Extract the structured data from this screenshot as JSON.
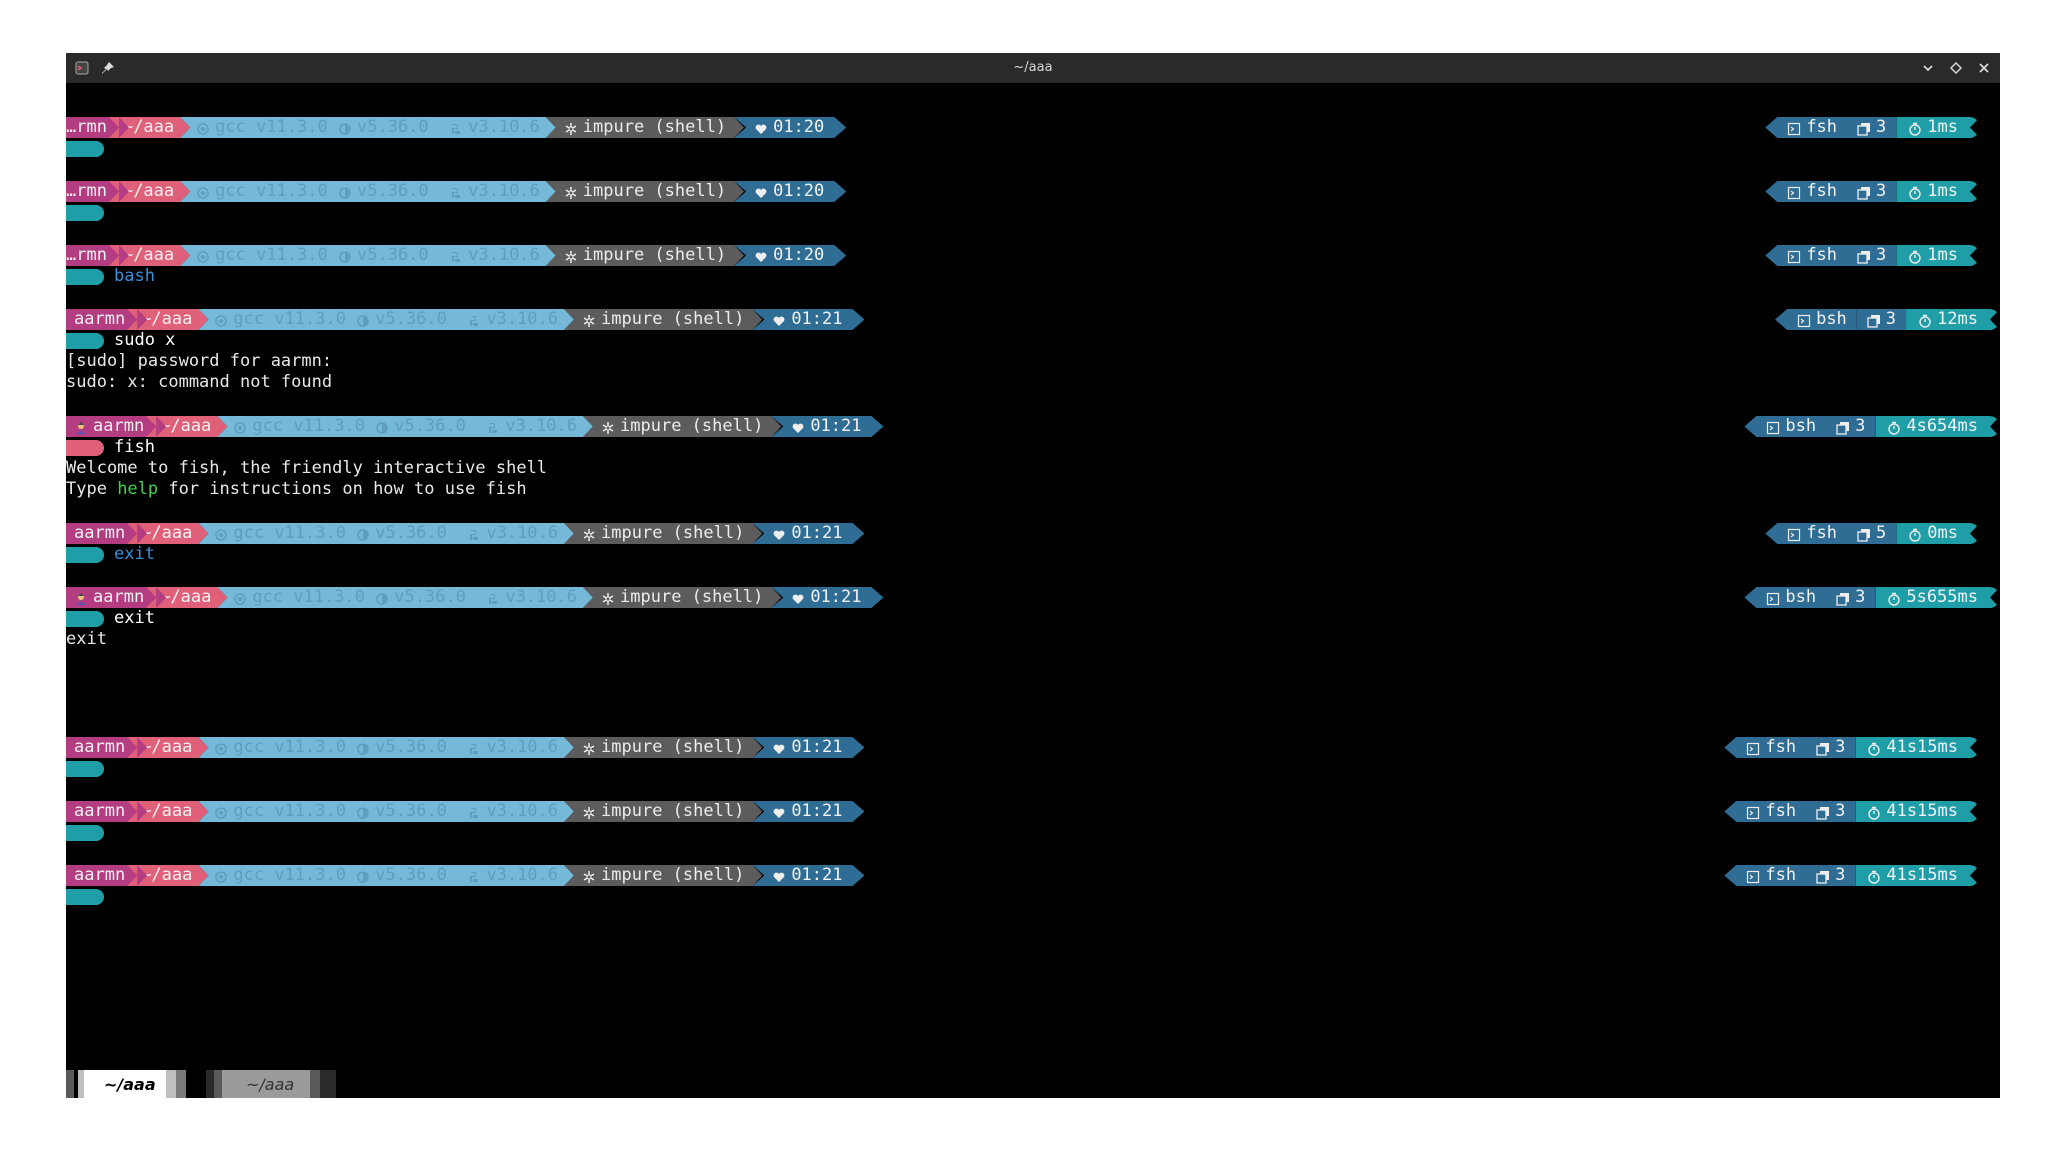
{
  "window": {
    "title": "~/aaa"
  },
  "colors": {
    "user": "#b43c80",
    "dir": "#e0607a",
    "tools": "#75b8d8",
    "nix": "#5c5c5c",
    "time": "#2f6d95",
    "duration": "#1f9ea8",
    "prompt_ok": "#1f9ea8",
    "prompt_err": "#e0607a"
  },
  "prompts": [
    {
      "user": "…rmn",
      "dir": "~/aaa",
      "gcc": "gcc v11.3.0",
      "perl": "v5.36.0",
      "python": "v3.10.6",
      "nix": "impure (shell)",
      "time": "01:20",
      "shell": "fsh",
      "jobs": "3",
      "duration": "1ms",
      "command": "",
      "command_color": "#ffffff",
      "pill": "ok"
    },
    {
      "user": "…rmn",
      "dir": "~/aaa",
      "gcc": "gcc v11.3.0",
      "perl": "v5.36.0",
      "python": "v3.10.6",
      "nix": "impure (shell)",
      "time": "01:20",
      "shell": "fsh",
      "jobs": "3",
      "duration": "1ms",
      "command": "",
      "command_color": "#ffffff",
      "pill": "ok"
    },
    {
      "user": "…rmn",
      "dir": "~/aaa",
      "gcc": "gcc v11.3.0",
      "perl": "v5.36.0",
      "python": "v3.10.6",
      "nix": "impure (shell)",
      "time": "01:20",
      "shell": "fsh",
      "jobs": "3",
      "duration": "1ms",
      "command": "bash",
      "command_color": "#3b8fd8",
      "pill": "ok"
    },
    {
      "user": "aarmn",
      "dir": "~/aaa",
      "gcc": "gcc v11.3.0",
      "perl": "v5.36.0",
      "python": "v3.10.6",
      "nix": "impure (shell)",
      "time": "01:21",
      "shell": "bsh",
      "jobs": "3",
      "duration": "12ms",
      "command": "sudo x",
      "command_color": "#ffffff",
      "pill": "ok"
    },
    {
      "user": "aarmn",
      "dir": "~/aaa",
      "gcc": "gcc v11.3.0",
      "perl": "v5.36.0",
      "python": "v3.10.6",
      "nix": "impure (shell)",
      "time": "01:21",
      "shell": "bsh",
      "jobs": "3",
      "duration": "4s654ms",
      "command": "fish",
      "command_color": "#ffffff",
      "pill": "err",
      "avatar": true
    },
    {
      "user": "aarmn",
      "dir": "~/aaa",
      "gcc": "gcc v11.3.0",
      "perl": "v5.36.0",
      "python": "v3.10.6",
      "nix": "impure (shell)",
      "time": "01:21",
      "shell": "fsh",
      "jobs": "5",
      "duration": "0ms",
      "command": "exit",
      "command_color": "#3b8fd8",
      "pill": "ok"
    },
    {
      "user": "aarmn",
      "dir": "~/aaa",
      "gcc": "gcc v11.3.0",
      "perl": "v5.36.0",
      "python": "v3.10.6",
      "nix": "impure (shell)",
      "time": "01:21",
      "shell": "bsh",
      "jobs": "3",
      "duration": "5s655ms",
      "command": "exit",
      "command_color": "#ffffff",
      "pill": "ok",
      "avatar": true
    },
    {
      "user": "aarmn",
      "dir": "~/aaa",
      "gcc": "gcc v11.3.0",
      "perl": "v5.36.0",
      "python": "v3.10.6",
      "nix": "impure (shell)",
      "time": "01:21",
      "shell": "fsh",
      "jobs": "3",
      "duration": "41s15ms",
      "command": "",
      "command_color": "#ffffff",
      "pill": "ok"
    },
    {
      "user": "aarmn",
      "dir": "~/aaa",
      "gcc": "gcc v11.3.0",
      "perl": "v5.36.0",
      "python": "v3.10.6",
      "nix": "impure (shell)",
      "time": "01:21",
      "shell": "fsh",
      "jobs": "3",
      "duration": "41s15ms",
      "command": "",
      "command_color": "#ffffff",
      "pill": "ok"
    },
    {
      "user": "aarmn",
      "dir": "~/aaa",
      "gcc": "gcc v11.3.0",
      "perl": "v5.36.0",
      "python": "v3.10.6",
      "nix": "impure (shell)",
      "time": "01:21",
      "shell": "fsh",
      "jobs": "3",
      "duration": "41s15ms",
      "command": "",
      "command_color": "#ffffff",
      "pill": "ok"
    }
  ],
  "outputs": {
    "sudo_prompt": "[sudo] password for aarmn:",
    "sudo_error": "sudo: x: command not found",
    "fish_welcome": "Welcome to fish, the friendly interactive shell",
    "fish_help_pre": "Type ",
    "fish_help_word": "help",
    "fish_help_post": " for instructions on how to use fish",
    "exit_echo": "exit"
  },
  "tabs": [
    {
      "label": "~/aaa",
      "active": true
    },
    {
      "label": "~/aaa",
      "active": false
    }
  ]
}
